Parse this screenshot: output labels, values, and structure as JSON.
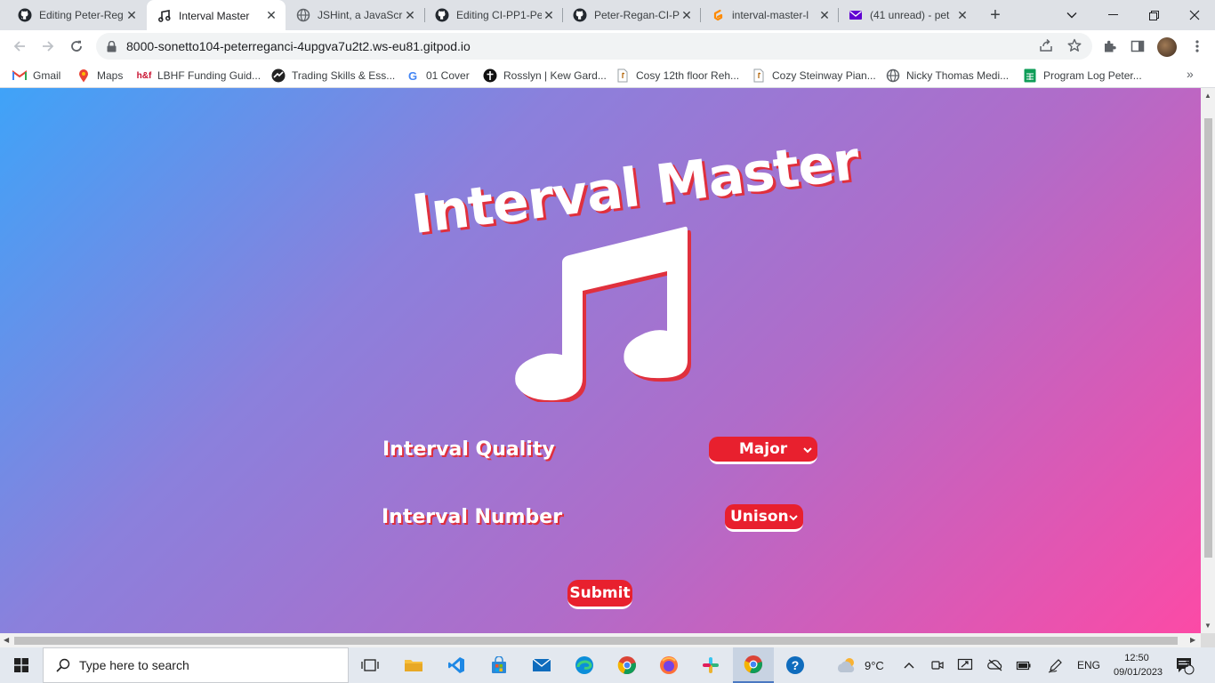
{
  "browser": {
    "tabs": [
      {
        "title": "Editing Peter-Reg",
        "icon": "github-icon",
        "active": false
      },
      {
        "title": "Interval Master",
        "icon": "music-note-icon",
        "active": true
      },
      {
        "title": "JSHint, a JavaScri",
        "icon": "globe-icon",
        "active": false
      },
      {
        "title": "Editing CI-PP1-Pe",
        "icon": "github-icon",
        "active": false
      },
      {
        "title": "Peter-Regan-CI-P",
        "icon": "github-icon",
        "active": false
      },
      {
        "title": "interval-master-l",
        "icon": "gitpod-icon",
        "active": false
      },
      {
        "title": "(41 unread) - pet",
        "icon": "mail-icon",
        "active": false
      }
    ],
    "url": "8000-sonetto104-peterreganci-4upgva7u2t2.ws-eu81.gitpod.io",
    "bookmarks": [
      {
        "label": "Gmail",
        "icon": "gmail-icon"
      },
      {
        "label": "Maps",
        "icon": "maps-icon"
      },
      {
        "label": "LBHF Funding Guid...",
        "icon": "hf-icon"
      },
      {
        "label": "Trading Skills & Ess...",
        "icon": "trading-icon"
      },
      {
        "label": "01 Cover",
        "icon": "google-icon"
      },
      {
        "label": "Rosslyn | Kew Gard...",
        "icon": "rosslyn-icon"
      },
      {
        "label": "Cosy 12th floor Reh...",
        "icon": "doc-icon"
      },
      {
        "label": "Cozy Steinway Pian...",
        "icon": "doc-icon"
      },
      {
        "label": "Nicky Thomas Medi...",
        "icon": "globe-icon"
      },
      {
        "label": "Program Log Peter...",
        "icon": "sheets-icon"
      }
    ]
  },
  "page": {
    "title": "Interval Master",
    "quality_label": "Interval Quality",
    "quality_value": "Major",
    "number_label": "Interval Number",
    "number_value": "Unison",
    "submit_label": "Submit"
  },
  "taskbar": {
    "search_placeholder": "Type here to search",
    "weather": "9°C",
    "language": "ENG",
    "time": "12:50",
    "date": "09/01/2023",
    "notification_count": "7"
  },
  "colors": {
    "accent_red": "#e8202e",
    "gradient_start": "#3fa3f8",
    "gradient_end": "#fc4aa6"
  }
}
